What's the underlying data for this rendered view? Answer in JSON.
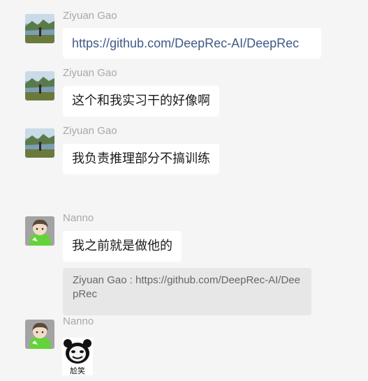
{
  "messages": [
    {
      "sender": "Ziyuan Gao",
      "text": "https://github.com/DeepRec-AI/DeepRec"
    },
    {
      "sender": "Ziyuan Gao",
      "text": "这个和我实习干的好像啊"
    },
    {
      "sender": "Ziyuan Gao",
      "text": "我负责推理部分不搞训练"
    },
    {
      "sender": "Nanno",
      "text": "我之前就是做他的",
      "quote": "Ziyuan Gao : https://github.com/DeepRec-AI/DeepRec"
    },
    {
      "sender": "Nanno",
      "sticker_caption": "尬笑"
    }
  ],
  "colors": {
    "background": "#f5f5f5",
    "bubble": "#ffffff",
    "link": "#3e5a86",
    "sender": "#a8a8a8",
    "quote_bg": "#e7e7e7"
  }
}
